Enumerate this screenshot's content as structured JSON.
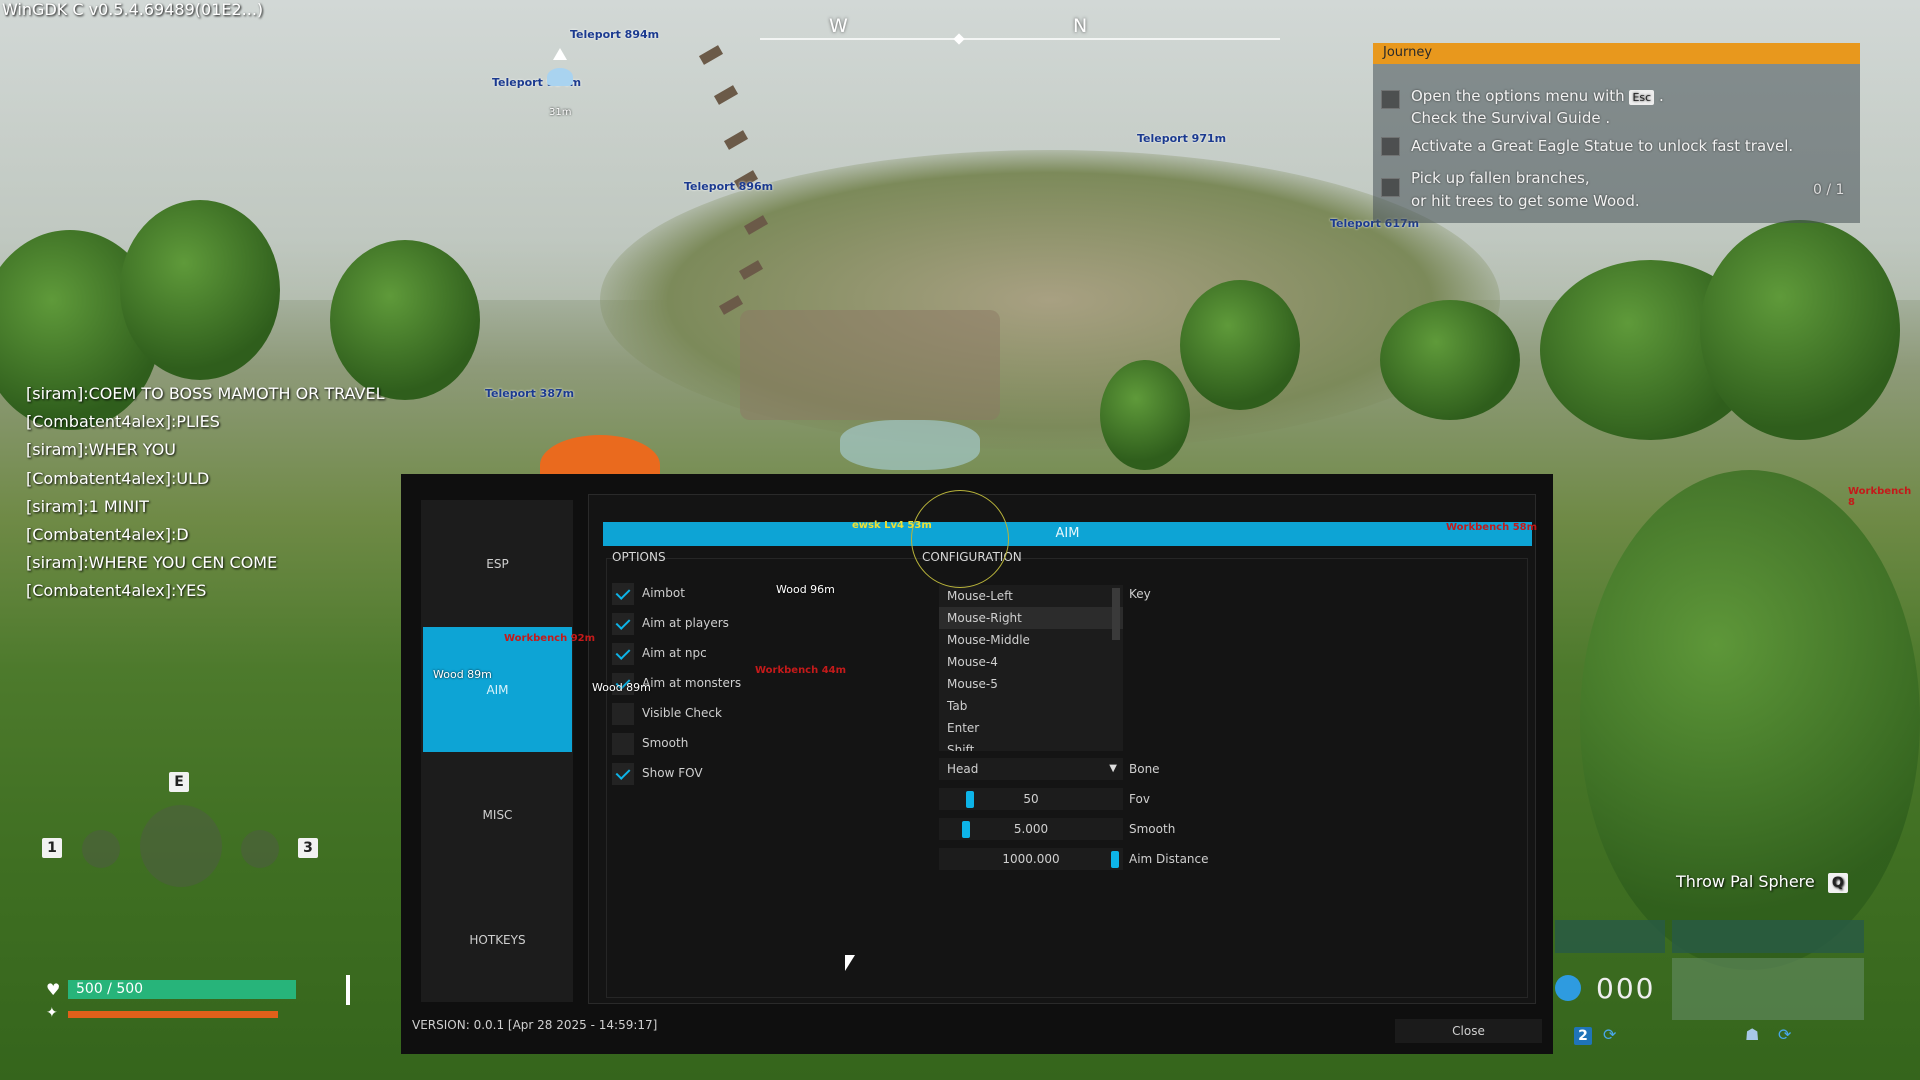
{
  "game": {
    "build_label": "WinGDK C v0.5.4.69489(01E2...)",
    "compass": {
      "w": "W",
      "n": "N"
    },
    "waypoints": [
      "Teleport 894m",
      "Teleport 994m",
      "31m",
      "Teleport 896m",
      "Teleport 971m",
      "Teleport 617m",
      "Teleport 387m",
      "ewsk Lv4 53m",
      "Workbench 58m",
      "Workbench 92m",
      "Wood 89m",
      "Wood 89m",
      "Workbench 44m",
      "Wood 96m",
      "Workbench 8"
    ],
    "journey": {
      "title": "Journey",
      "task1_line1": "Open the options menu with",
      "task1_key": "Esc",
      "task1_line2": "Check the  Survival Guide .",
      "task2": "Activate a Great Eagle Statue to unlock fast travel.",
      "task3_line1": "Pick up fallen branches,",
      "task3_line2": "or hit trees to get some Wood.",
      "task3_progress": "0 / 1"
    },
    "chat": [
      "[siram]:COEM TO BOSS MAMOTH OR TRAVEL",
      "[Combatent4alex]:PLIES",
      "[siram]:WHER YOU",
      "[Combatent4alex]:ULD",
      "[siram]:1 MINIT",
      "[Combatent4alex]:D",
      "[siram]:WHERE YOU CEN COME",
      "[Combatent4alex]:YES"
    ],
    "hud": {
      "health": "500 / 500",
      "health_fraction": 1.0,
      "key_e": "E",
      "key_1": "1",
      "key_3": "3",
      "throw_label": "Throw Pal Sphere",
      "throw_key": "Q",
      "ammo": "000",
      "key_2": "2"
    }
  },
  "menu": {
    "tabs": [
      "ESP",
      "AIM",
      "MISC",
      "HOTKEYS"
    ],
    "active_tab": "AIM",
    "section_title": "AIM",
    "options_header": "OPTIONS",
    "config_header": "CONFIGURATION",
    "options": [
      {
        "label": "Aimbot",
        "checked": true
      },
      {
        "label": "Aim at players",
        "checked": true
      },
      {
        "label": "Aim at npc",
        "checked": true
      },
      {
        "label": "Aim at monsters",
        "checked": true
      },
      {
        "label": "Visible Check",
        "checked": false
      },
      {
        "label": "Smooth",
        "checked": false
      },
      {
        "label": "Show FOV",
        "checked": true
      }
    ],
    "key_list": [
      "Mouse-Left",
      "Mouse-Right",
      "Mouse-Middle",
      "Mouse-4",
      "Mouse-5",
      "Tab",
      "Enter",
      "Shift"
    ],
    "key_selected": "Mouse-Right",
    "key_label": "Key",
    "bone_value": "Head",
    "bone_label": "Bone",
    "fov_value": "50",
    "fov_label": "Fov",
    "smooth_value": "5.000",
    "smooth_label": "Smooth",
    "aim_distance_value": "1000.000",
    "aim_distance_label": "Aim Distance",
    "version": "VERSION: 0.0.1 [Apr 28 2025 - 14:59:17]",
    "close_label": "Close"
  }
}
